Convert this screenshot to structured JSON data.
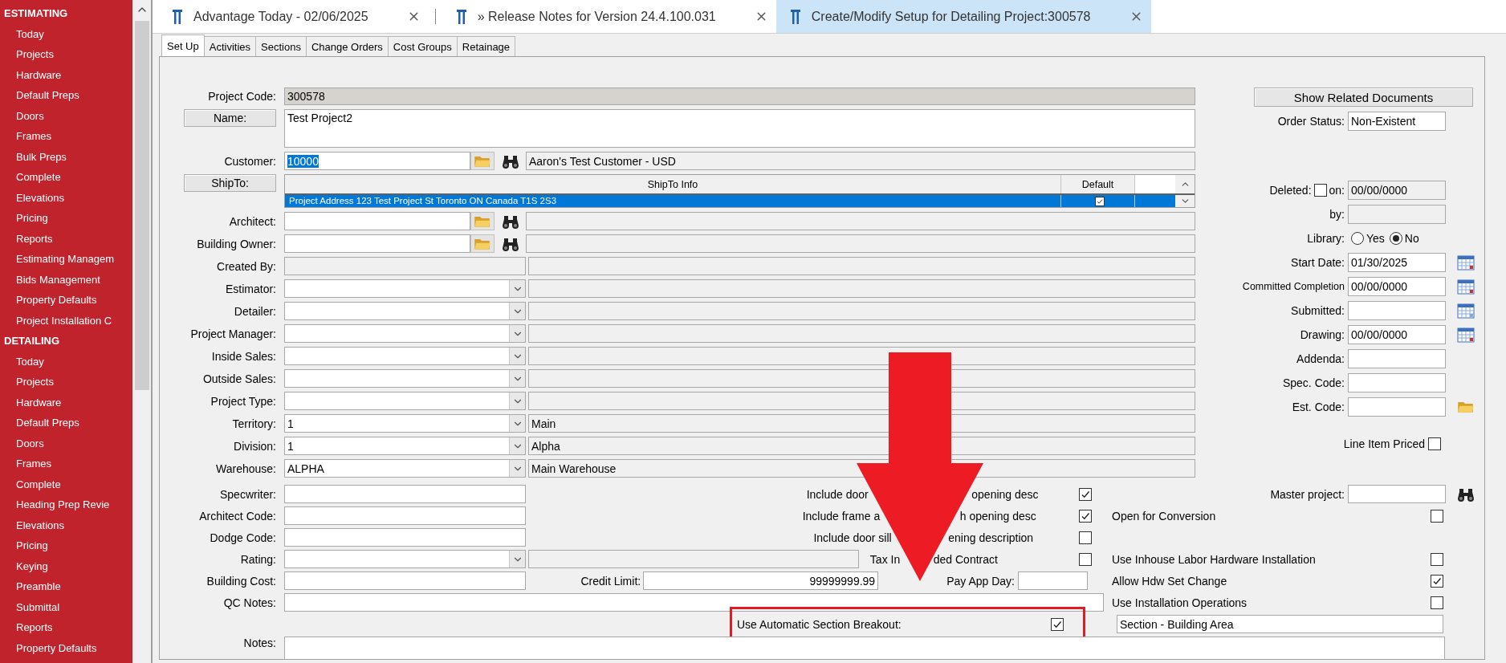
{
  "sidebar": {
    "sections": [
      {
        "title": "ESTIMATING",
        "items": [
          "Today",
          "Projects",
          "Hardware",
          "Default Preps",
          "Doors",
          "Frames",
          "Bulk Preps",
          "Complete",
          "Elevations",
          "Pricing",
          "Reports",
          "Estimating Managem",
          "Bids Management",
          "Property Defaults",
          "Project Installation C"
        ]
      },
      {
        "title": "DETAILING",
        "items": [
          "Today",
          "Projects",
          "Hardware",
          "Default Preps",
          "Doors",
          "Frames",
          "Complete",
          "Heading Prep Revie",
          "Elevations",
          "Pricing",
          "Keying",
          "Preamble",
          "Submittal",
          "Reports",
          "Property Defaults"
        ]
      }
    ]
  },
  "tabs": [
    {
      "label": "Advantage Today - 02/06/2025",
      "selected": false
    },
    {
      "label": "» Release Notes for Version 24.4.100.031",
      "selected": false
    },
    {
      "label": "Create/Modify Setup for Detailing Project:300578",
      "selected": true
    }
  ],
  "subtabs": [
    {
      "label": "Set Up",
      "selected": true
    },
    {
      "label": "Activities",
      "selected": false
    },
    {
      "label": "Sections",
      "selected": false
    },
    {
      "label": "Change Orders",
      "selected": false
    },
    {
      "label": "Cost Groups",
      "selected": false
    },
    {
      "label": "Retainage",
      "selected": false
    }
  ],
  "left_rows": [
    {
      "kind": "readonly",
      "label": "Project Code:",
      "value": "300578"
    },
    {
      "kind": "memo",
      "label": "Name:",
      "value": "Test Project2"
    },
    {
      "kind": "lookup",
      "label": "Customer:",
      "value": "10000",
      "text_selected": true,
      "description": "Aaron's Test Customer - USD"
    },
    {
      "kind": "grid",
      "label": "ShipTo:",
      "columns": [
        "ShipTo Info",
        "Default"
      ],
      "rows": [
        {
          "info": "Project Address 123 Test Project St Toronto ON Canada T1S 2S3",
          "default": true,
          "selected": true
        }
      ]
    },
    {
      "kind": "lookup",
      "label": "Architect:"
    },
    {
      "kind": "lookup",
      "label": "Building Owner:"
    },
    {
      "kind": "info",
      "label": "Created By:"
    },
    {
      "kind": "dropdown",
      "label": "Estimator:"
    },
    {
      "kind": "dropdown",
      "label": "Detailer:"
    },
    {
      "kind": "dropdown",
      "label": "Project Manager:"
    },
    {
      "kind": "dropdown",
      "label": "Inside Sales:"
    },
    {
      "kind": "dropdown",
      "label": "Outside Sales:"
    },
    {
      "kind": "dropdown",
      "label": "Project Type:"
    },
    {
      "kind": "dropdown",
      "label": "Territory:",
      "value": "1",
      "description": "Main"
    },
    {
      "kind": "dropdown",
      "label": "Division:",
      "value": "1",
      "description": "Alpha"
    },
    {
      "kind": "dropdown",
      "label": "Warehouse:",
      "value": "ALPHA",
      "description": "Main Warehouse"
    }
  ],
  "right_rows": [
    {
      "kind": "button",
      "label": "Show Related Documents"
    },
    {
      "kind": "field",
      "label": "Order Status:",
      "value": "Non-Existent"
    },
    {
      "kind": "deleted",
      "label": "Deleted:",
      "checked": false,
      "on_label": "on:",
      "value": "00/00/0000"
    },
    {
      "kind": "readonly",
      "label": "by:"
    },
    {
      "kind": "radio",
      "label": "Library:",
      "options": [
        {
          "label": "Yes",
          "selected": false
        },
        {
          "label": "No",
          "selected": true
        }
      ]
    },
    {
      "kind": "date",
      "label": "Start Date:",
      "value": "01/30/2025"
    },
    {
      "kind": "date",
      "label": "Committed Completion",
      "value": "00/00/0000",
      "small": true
    },
    {
      "kind": "date",
      "label": "Submitted:"
    },
    {
      "kind": "date",
      "label": "Drawing:",
      "value": "00/00/0000"
    },
    {
      "kind": "field",
      "label": "Addenda:"
    },
    {
      "kind": "field",
      "label": "Spec. Code:"
    },
    {
      "kind": "folder",
      "label": "Est. Code:"
    },
    {
      "kind": "check",
      "label": "Line Item Priced",
      "checked": false
    }
  ],
  "lower_fields": [
    {
      "kind": "input",
      "label": "Specwriter:"
    },
    {
      "kind": "input",
      "label": "Architect Code:"
    },
    {
      "kind": "input",
      "label": "Dodge Code:"
    },
    {
      "kind": "dropdown",
      "label": "Rating:"
    },
    {
      "kind": "input",
      "label": "Building Cost:"
    }
  ],
  "options": [
    {
      "parts": [
        "Include door",
        "opening desc"
      ],
      "checked": true
    },
    {
      "parts": [
        "Include frame a",
        "h opening desc"
      ],
      "checked": true
    },
    {
      "parts": [
        "Include door sill",
        "ening description"
      ],
      "checked": false
    },
    {
      "parts": [
        "Tax In",
        "ded Contract"
      ],
      "checked": false
    }
  ],
  "credit_limit": {
    "label": "Credit Limit:",
    "value": "99999999.99"
  },
  "pay_app_day": {
    "label": "Pay App Day:"
  },
  "qc_notes": {
    "label": "QC Notes:"
  },
  "auto_section": {
    "label": "Use Automatic Section Breakout:",
    "checked": true,
    "value": "Section - Building Area"
  },
  "notes": {
    "label": "Notes:"
  },
  "master_project": {
    "label": "Master project:"
  },
  "flags": [
    {
      "label": "Open for Conversion",
      "checked": false
    },
    {
      "label": "Use Inhouse Labor Hardware Installation",
      "checked": false
    },
    {
      "label": "Allow Hdw Set Change",
      "checked": true
    },
    {
      "label": "Use Installation Operations",
      "checked": false
    }
  ]
}
